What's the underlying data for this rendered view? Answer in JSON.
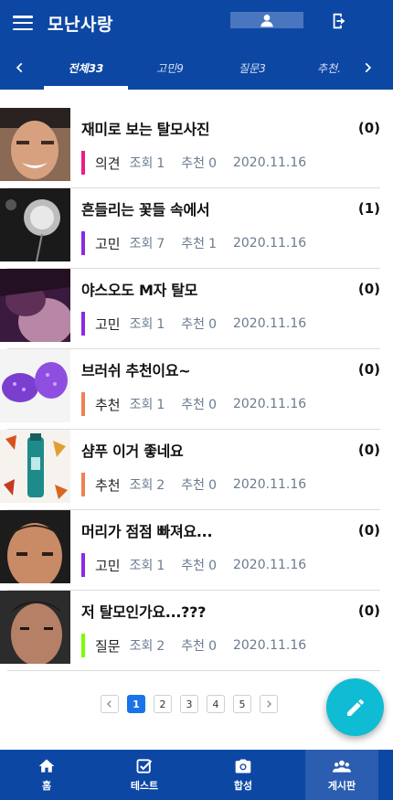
{
  "header": {
    "title": "모난사랑"
  },
  "tabs": [
    {
      "label": "전체33",
      "active": true
    },
    {
      "label": "고민9",
      "active": false
    },
    {
      "label": "질문3",
      "active": false
    },
    {
      "label": "추천.",
      "active": false
    }
  ],
  "posts": [
    {
      "title": "재미로 보는 탈모사진",
      "count": "(0)",
      "category": "의견",
      "category_color": "#e91e8c",
      "views_label": "조회",
      "views": "1",
      "recommend_label": "추천",
      "recommends": "0",
      "date": "2020.11.16"
    },
    {
      "title": "흔들리는 꽃들 속에서",
      "count": "(1)",
      "category": "고민",
      "category_color": "#8a2be2",
      "views_label": "조회",
      "views": "7",
      "recommend_label": "추천",
      "recommends": "1",
      "date": "2020.11.16"
    },
    {
      "title": "야스오도 M자 탈모",
      "count": "(0)",
      "category": "고민",
      "category_color": "#8a2be2",
      "views_label": "조회",
      "views": "1",
      "recommend_label": "추천",
      "recommends": "0",
      "date": "2020.11.16"
    },
    {
      "title": "브러쉬 추천이요~",
      "count": "(0)",
      "category": "추천",
      "category_color": "#f08050",
      "views_label": "조회",
      "views": "1",
      "recommend_label": "추천",
      "recommends": "0",
      "date": "2020.11.16"
    },
    {
      "title": "샴푸 이거 좋네요",
      "count": "(0)",
      "category": "추천",
      "category_color": "#f08050",
      "views_label": "조회",
      "views": "2",
      "recommend_label": "추천",
      "recommends": "0",
      "date": "2020.11.16"
    },
    {
      "title": "머리가 점점 빠져요...",
      "count": "(0)",
      "category": "고민",
      "category_color": "#8a2be2",
      "views_label": "조회",
      "views": "1",
      "recommend_label": "추천",
      "recommends": "0",
      "date": "2020.11.16"
    },
    {
      "title": "저 탈모인가요...???",
      "count": "(0)",
      "category": "질문",
      "category_color": "#7cfc00",
      "views_label": "조회",
      "views": "2",
      "recommend_label": "추천",
      "recommends": "0",
      "date": "2020.11.16"
    }
  ],
  "pagination": {
    "pages": [
      "1",
      "2",
      "3",
      "4",
      "5"
    ],
    "current": "1"
  },
  "bottom_nav": [
    {
      "label": "홈",
      "icon": "home-icon",
      "active": false
    },
    {
      "label": "테스트",
      "icon": "checkbox-icon",
      "active": false
    },
    {
      "label": "합성",
      "icon": "camera-icon",
      "active": false
    },
    {
      "label": "게시판",
      "icon": "group-icon",
      "active": true
    }
  ],
  "colors": {
    "primary": "#0c47a4",
    "fab": "#10bcd4",
    "active_page": "#1a73e8"
  }
}
